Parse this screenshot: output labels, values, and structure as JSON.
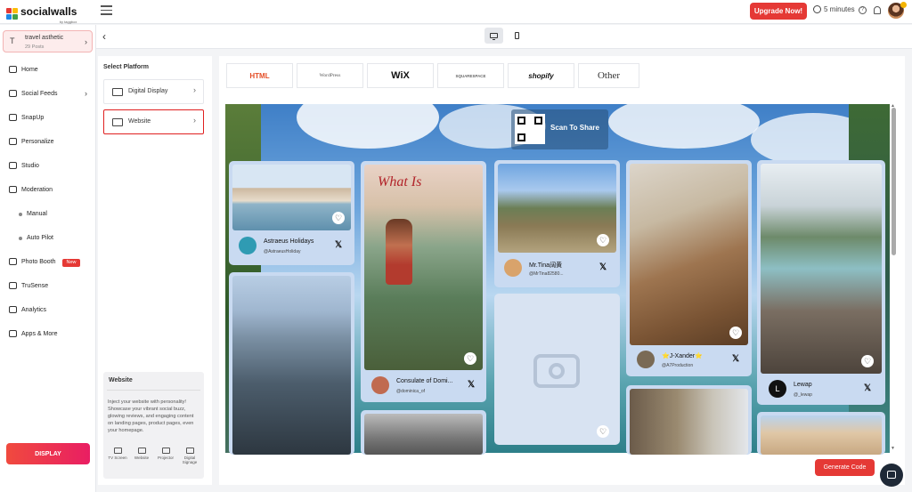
{
  "header": {
    "logo_text": "socialwalls",
    "logo_sub": "by taggbox",
    "upgrade_label": "Upgrade Now!",
    "timer_text": "5 minutes",
    "icons": [
      "menu-icon",
      "clock-icon",
      "help-icon",
      "bell-icon",
      "avatar"
    ]
  },
  "wall": {
    "initial": "T",
    "name": "travel asthetic",
    "post_count": "29 Posts"
  },
  "sidebar": {
    "items": [
      {
        "label": "Home",
        "icon": "home-icon"
      },
      {
        "label": "Social Feeds",
        "icon": "social-feeds-icon"
      },
      {
        "label": "SnapUp",
        "icon": "snapup-icon"
      },
      {
        "label": "Personalize",
        "icon": "personalize-icon"
      },
      {
        "label": "Studio",
        "icon": "studio-icon"
      },
      {
        "label": "Moderation",
        "icon": "moderation-icon"
      },
      {
        "label": "Manual"
      },
      {
        "label": "Auto Pilot"
      },
      {
        "label": "Photo Booth",
        "icon": "photo-booth-icon",
        "badge": "New"
      },
      {
        "label": "TruSense",
        "icon": "trusense-icon"
      },
      {
        "label": "Analytics",
        "icon": "analytics-icon"
      },
      {
        "label": "Apps & More",
        "icon": "apps-icon"
      }
    ],
    "display_label": "DISPLAY"
  },
  "platform": {
    "title": "Select Platform",
    "options": [
      {
        "label": "Digital Display",
        "selected": false
      },
      {
        "label": "Website",
        "selected": true
      }
    ],
    "info": {
      "title": "Website",
      "description": "Inject your website with personality! Showcase your vibrant social buzz, glowing reviews, and engaging content on landing pages, product pages, even your homepage.",
      "icons": [
        "TV Screen",
        "Website",
        "Projector",
        "Digital Signage"
      ]
    }
  },
  "cms": [
    "HTML",
    "WordPress",
    "WiX",
    "SQUARESPACE",
    "shopify",
    "Other"
  ],
  "preview": {
    "qr_label": "Scan To Share",
    "posts": [
      {
        "name": "Astraeus Holidays",
        "handle": "@AstraeusHoliday"
      },
      {
        "name": "Consulate of Domi...",
        "handle": "@dominica_of",
        "overlay": "What Is"
      },
      {
        "name": "Mr.Tina阔黄",
        "handle": "@MrTina82580..."
      },
      {
        "name": "⭐J-Xander⭐",
        "handle": "@A7Production"
      },
      {
        "name": "Lewap",
        "handle": "@_lewap",
        "initial": "L"
      }
    ]
  },
  "generate_label": "Generate Code",
  "colors": {
    "accent": "#e53935",
    "selection": "#e02020"
  }
}
